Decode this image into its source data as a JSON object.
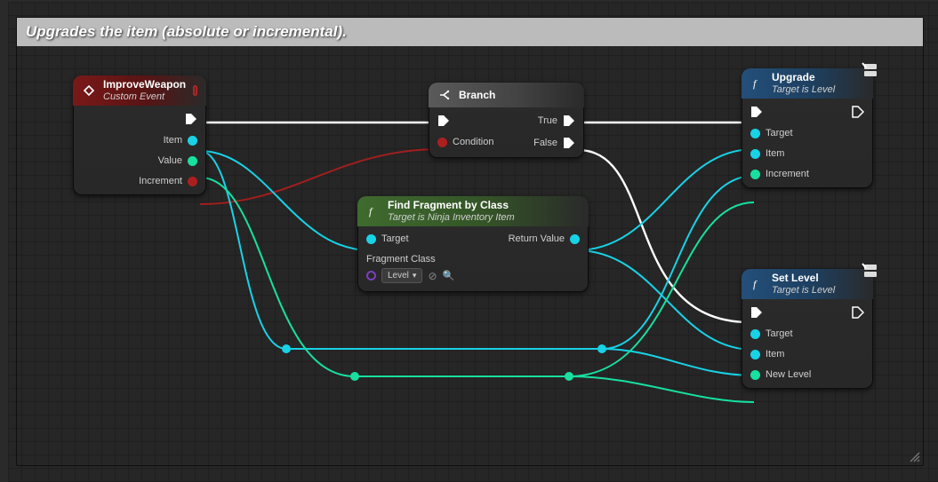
{
  "comment": {
    "title": "Upgrades the item (absolute or incremental)."
  },
  "nodes": {
    "improve": {
      "title": "ImproveWeapon",
      "subtitle": "Custom Event",
      "pins": {
        "item": "Item",
        "value": "Value",
        "increment": "Increment"
      }
    },
    "branch": {
      "title": "Branch",
      "pins": {
        "condition": "Condition",
        "true": "True",
        "false": "False"
      }
    },
    "find": {
      "title": "Find Fragment by Class",
      "subtitle": "Target is Ninja Inventory Item",
      "pins": {
        "target": "Target",
        "fragClass": "Fragment Class",
        "fragValue": "Level",
        "ret": "Return Value"
      }
    },
    "upgrade": {
      "title": "Upgrade",
      "subtitle": "Target is Level",
      "pins": {
        "target": "Target",
        "item": "Item",
        "increment": "Increment"
      }
    },
    "setlevel": {
      "title": "Set Level",
      "subtitle": "Target is Level",
      "pins": {
        "target": "Target",
        "item": "Item",
        "newlevel": "New Level"
      }
    }
  }
}
